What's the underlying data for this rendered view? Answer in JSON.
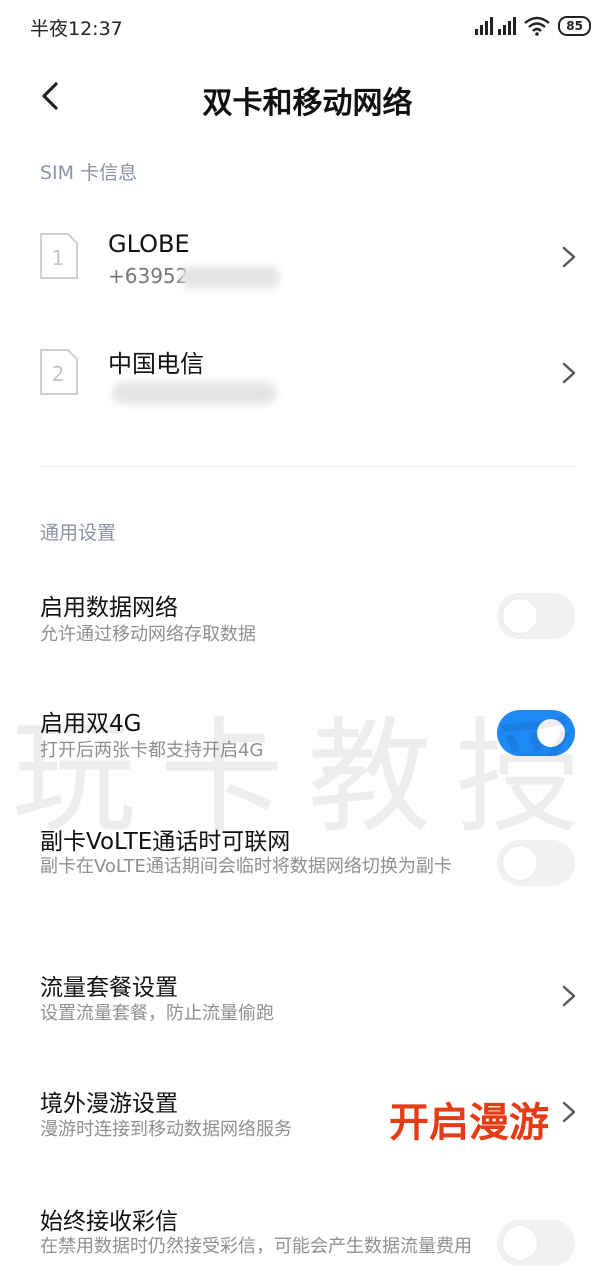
{
  "status_bar": {
    "time": "半夜12:37",
    "battery": "85"
  },
  "header": {
    "title": "双卡和移动网络",
    "back_icon": "chevron-left-icon"
  },
  "sim_section": {
    "label": "SIM 卡信息",
    "cards": [
      {
        "slot": "1",
        "name": "GLOBE",
        "number": "+63952"
      },
      {
        "slot": "2",
        "name": "中国电信",
        "number": ""
      }
    ]
  },
  "general_section": {
    "label": "通用设置",
    "settings": [
      {
        "title": "启用数据网络",
        "subtitle": "允许通过移动网络存取数据",
        "control": "toggle",
        "enabled": false
      },
      {
        "title": "启用双4G",
        "subtitle": "打开后两张卡都支持开启4G",
        "control": "toggle",
        "enabled": true
      },
      {
        "title": "副卡VoLTE通话时可联网",
        "subtitle": "副卡在VoLTE通话期间会临时将数据网络切换为副卡",
        "control": "toggle",
        "enabled": false
      },
      {
        "title": "流量套餐设置",
        "subtitle": "设置流量套餐，防止流量偷跑",
        "control": "chevron"
      },
      {
        "title": "境外漫游设置",
        "subtitle": "漫游时连接到移动数据网络服务",
        "control": "chevron"
      },
      {
        "title": "始终接收彩信",
        "subtitle": "在禁用数据时仍然接受彩信，可能会产生数据流量费用",
        "control": "toggle",
        "enabled": false
      }
    ]
  },
  "overlay": {
    "watermark": "玩卡教授",
    "annotation": "开启漫游"
  },
  "colors": {
    "accent": "#1e88f5",
    "annotation": "#e53b16",
    "section_label": "#8a93a6"
  }
}
